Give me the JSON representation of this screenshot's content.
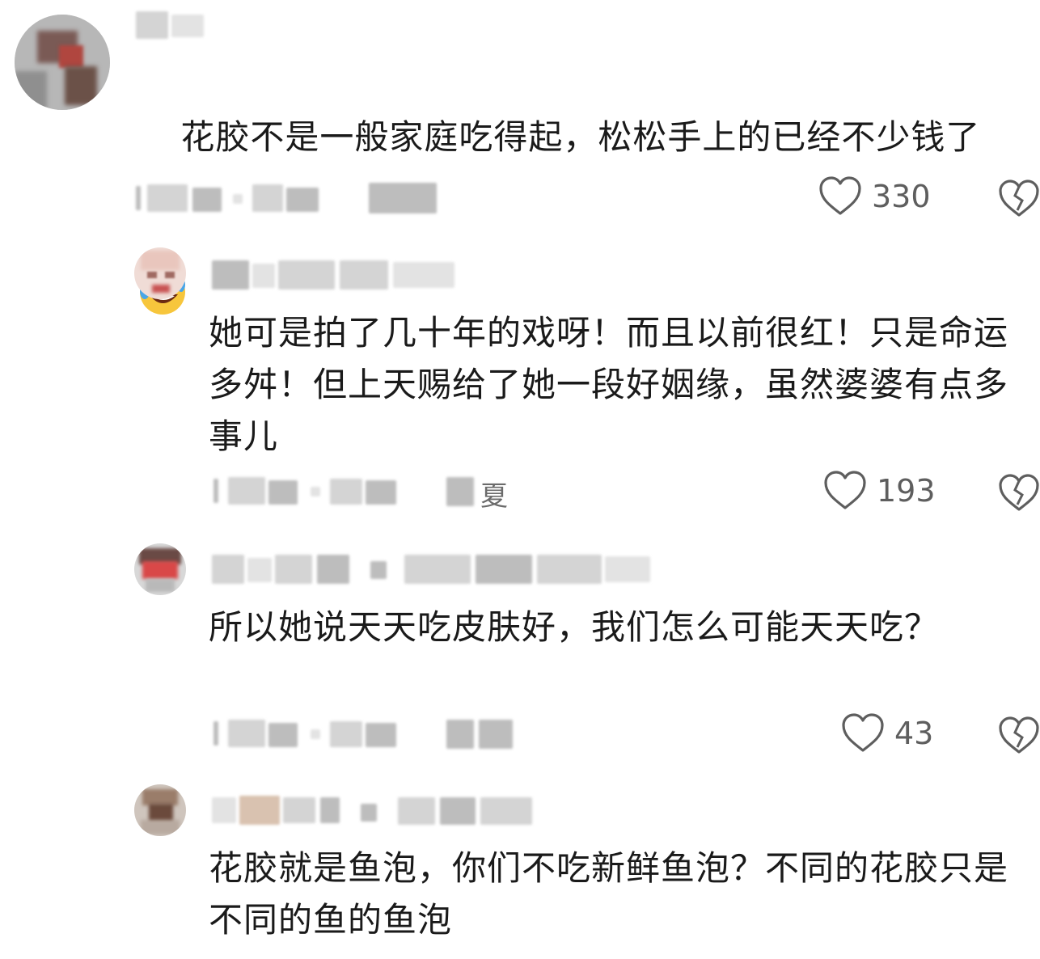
{
  "comments": [
    {
      "text": "花胶不是一般家庭吃得起，松松手上的已经不少钱了",
      "likes": "330",
      "emoji": "rolling-on-floor-laughing"
    },
    {
      "text": "她可是拍了几十年的戏呀！而且以前很红！只是命运多舛！但上天赐给了她一段好姻缘，虽然婆婆有点多事儿",
      "likes": "193",
      "reply_label_partial": "夏"
    },
    {
      "text": "所以她说天天吃皮肤好，我们怎么可能天天吃？",
      "likes": "43"
    },
    {
      "text": "花胶就是鱼泡，你们不吃新鲜鱼泡？不同的花胶只是不同的鱼的鱼泡"
    }
  ],
  "icons": {
    "like": "heart-outline-icon",
    "dislike": "broken-heart-icon"
  },
  "colors": {
    "text": "#1a1a1a",
    "meta": "#5e5e5e",
    "background": "#ffffff"
  }
}
